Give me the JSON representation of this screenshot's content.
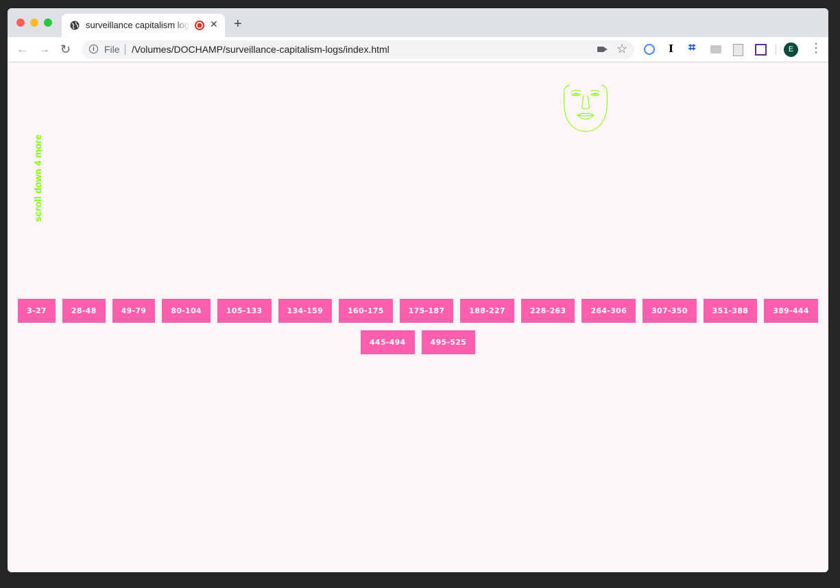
{
  "browser": {
    "tab_title": "surveillance capitalism logs",
    "new_tab_symbol": "+",
    "close_symbol": "✕",
    "omnibox_scheme_label": "File",
    "url": "/Volumes/DOCHAMP/surveillance-capitalism-logs/index.html",
    "avatar_initial": "E",
    "extension_labels": {
      "instapaper": "I",
      "hashtag": "⌗"
    }
  },
  "page": {
    "scroll_hint": "scroll down 4 more",
    "ranges_row1": [
      "3-27",
      "28-48",
      "49-79",
      "80-104",
      "105-133",
      "134-159",
      "160-175",
      "175-187",
      "188-227",
      "228-263",
      "264-306",
      "307-350",
      "351-388",
      "389-444"
    ],
    "ranges_row2": [
      "445-494",
      "495-525"
    ],
    "accent_pink": "#ff5fad",
    "accent_green": "#7cfc00"
  }
}
